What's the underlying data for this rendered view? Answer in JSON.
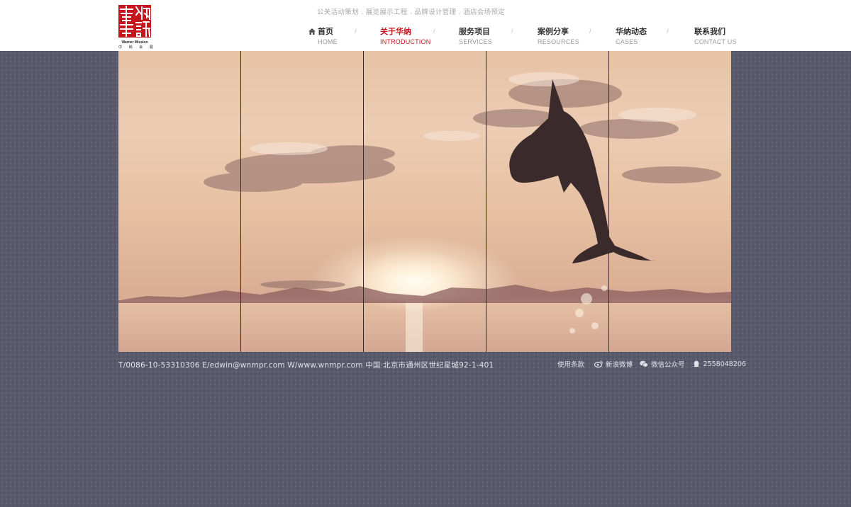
{
  "header": {
    "logo": {
      "seal_text": "華納集訊",
      "brand_en": "Warner Mission",
      "brand_cn": "中 纳 会 展"
    },
    "tagline": "公关活动策划 . 展览展示工程 . 品牌设计管理 . 酒店会场预定"
  },
  "nav": {
    "separator": "/",
    "items": [
      {
        "cn": "首页",
        "en": "HOME",
        "icon": "home-icon"
      },
      {
        "cn": "关于华纳",
        "en": "INTRODUCTION",
        "active": true
      },
      {
        "cn": "服务项目",
        "en": "SERVICES"
      },
      {
        "cn": "案例分享",
        "en": "RESOURCES"
      },
      {
        "cn": "华纳动态",
        "en": "CASES"
      },
      {
        "cn": "联系我们",
        "en": "CONTACT US"
      }
    ]
  },
  "banner": {
    "description_icon": "dolphin-sunset-image",
    "panels": 5
  },
  "footer": {
    "contact": "T/0086-10-53310306  E/edwin@wnmpr.com  W/www.wnmpr.com   中国·北京市通州区世纪星城92-1-401",
    "terms_label": "使用条款",
    "weibo_label": "新浪微博",
    "wechat_label": "微信公众号",
    "qq_number": "2558048206"
  },
  "colors": {
    "accent": "#c4161c",
    "background": "#585a6b",
    "header_bg": "#ffffff"
  }
}
